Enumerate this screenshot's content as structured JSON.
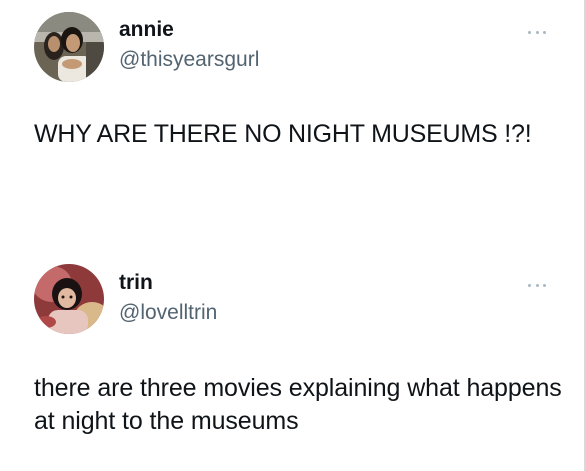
{
  "tweets": [
    {
      "display_name": "annie",
      "handle": "@thisyearsgurl",
      "text": "WHY ARE THERE NO NIGHT MUSEUMS !?!",
      "more_icon": "more-horizontal-icon"
    },
    {
      "display_name": "trin",
      "handle": "@lovelltrin",
      "text": "there are three movies explaining what happens at night to the museums",
      "more_icon": "more-horizontal-icon"
    }
  ],
  "colors": {
    "text_primary": "#0f1419",
    "text_secondary": "#536471",
    "icon_muted": "#aab8c2",
    "background": "#ffffff"
  }
}
